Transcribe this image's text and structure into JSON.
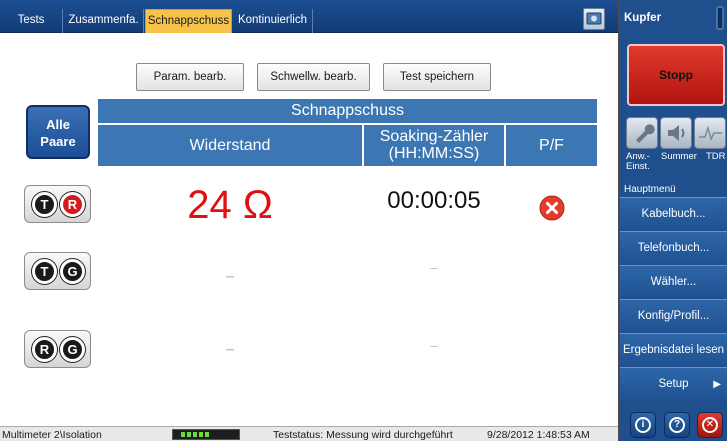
{
  "tabs": [
    {
      "label": "Tests",
      "active": false
    },
    {
      "label": "Zusammenfa.",
      "active": false
    },
    {
      "label": "Schnappschuss",
      "active": true
    },
    {
      "label": "Kontinuierlich",
      "active": false
    }
  ],
  "toolbar": {
    "param_label": "Param. bearb.",
    "threshold_label": "Schwellw. bearb.",
    "save_label": "Test speichern"
  },
  "all_pairs": {
    "line1": "Alle",
    "line2": "Paare"
  },
  "table": {
    "title": "Schnappschuss",
    "col_resistance": "Widerstand",
    "col_soak_line1": "Soaking-Zähler",
    "col_soak_line2": "(HH:MM:SS)",
    "col_pf": "P/F"
  },
  "pairs": [
    {
      "a": "T",
      "b": "R",
      "b_red": true,
      "resistance": "24 Ω",
      "soak": "00:00:05",
      "result": "fail"
    },
    {
      "a": "T",
      "b": "G",
      "b_red": false,
      "resistance": "–",
      "soak": "–",
      "result": ""
    },
    {
      "a": "R",
      "b": "G",
      "b_red": false,
      "resistance": "–",
      "soak": "–",
      "result": ""
    }
  ],
  "status": {
    "mode": "Multimeter 2\\Isolation",
    "test_status": "Teststatus: Messung wird durchgeführt",
    "datetime": "9/28/2012 1:48:53 AM"
  },
  "side": {
    "title": "Kupfer",
    "stop_label": "Stopp",
    "tools": [
      {
        "icon": "wrench-icon",
        "label": "Anw.-\nEinst."
      },
      {
        "icon": "speaker-icon",
        "label": "Summer"
      },
      {
        "icon": "tdr-icon",
        "label": "TDR"
      }
    ],
    "menu_header": "Hauptmenü",
    "menu": [
      {
        "label": "Kabelbuch..."
      },
      {
        "label": "Telefonbuch..."
      },
      {
        "label": "Wähler..."
      },
      {
        "label": "Konfig/Profil..."
      },
      {
        "label": "Ergebnisdatei lesen"
      },
      {
        "label": "Setup"
      }
    ]
  },
  "colors": {
    "accent_blue": "#3c77b3",
    "active_tab": "#f7c24a",
    "stop_red": "#c8201a",
    "value_red": "#e01010"
  }
}
